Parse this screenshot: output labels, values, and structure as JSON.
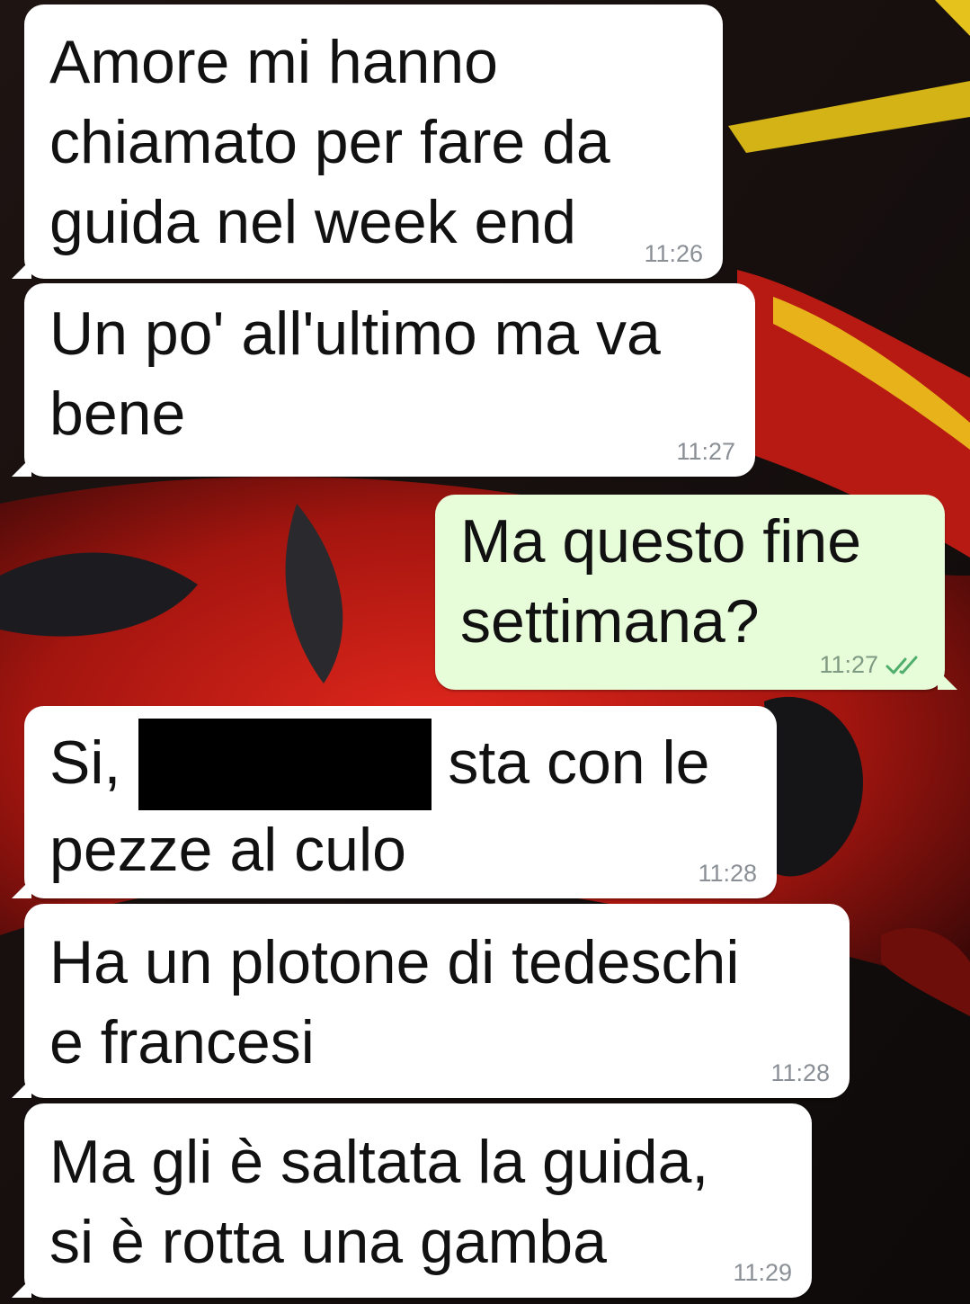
{
  "messages": [
    {
      "direction": "in",
      "text": "Amore mi hanno\nchiamato per fare da\nguida nel week end",
      "time": "11:26"
    },
    {
      "direction": "in",
      "text": "Un po' all'ultimo ma va\nbene",
      "time": "11:27"
    },
    {
      "direction": "out",
      "text": "Ma questo fine\nsettimana?",
      "time": "11:27",
      "status_icon": "double-check-icon"
    },
    {
      "direction": "in",
      "text_before": "Si,",
      "text_after": "sta con le",
      "text_line2": "pezze al culo",
      "time": "11:28"
    },
    {
      "direction": "in",
      "text": "Ha un plotone di tedeschi\ne francesi",
      "time": "11:28"
    },
    {
      "direction": "in",
      "text": "Ma gli è saltata la guida,\nsi è rotta una gamba",
      "time": "11:29"
    }
  ],
  "colors": {
    "incoming_bubble": "#ffffff",
    "outgoing_bubble": "#e7fcd9",
    "read_ticks": "#4fae6b",
    "redaction": "#000000"
  }
}
